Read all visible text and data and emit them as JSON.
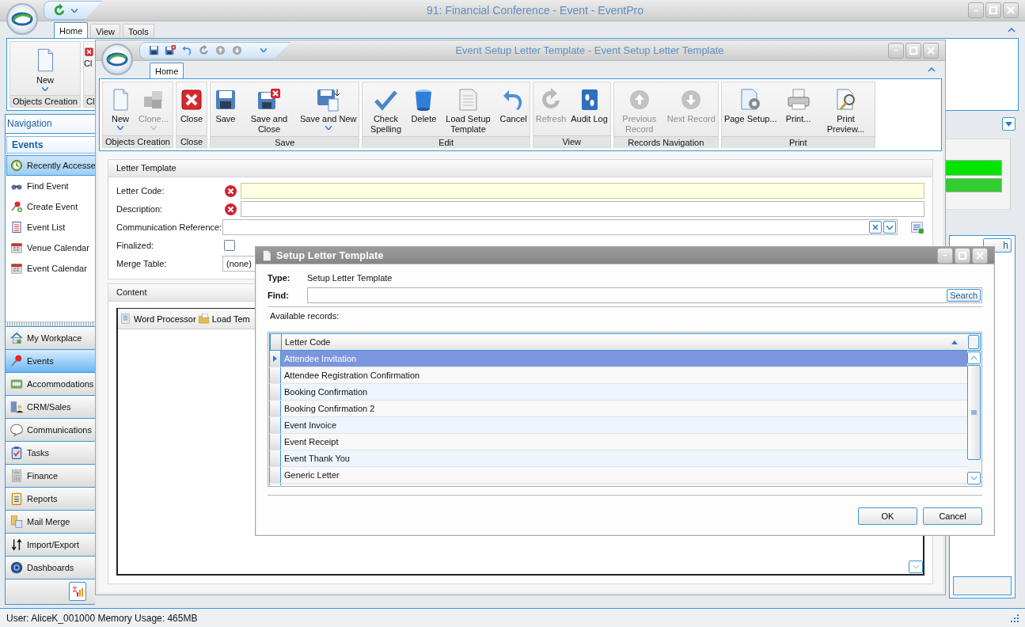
{
  "main_window": {
    "title": "91: Financial Conference - Event - EventPro",
    "tabs": [
      {
        "label": "Home",
        "selected": true
      },
      {
        "label": "View",
        "selected": false
      },
      {
        "label": "Tools",
        "selected": false
      }
    ],
    "ribbon_groups": [
      {
        "label": "Objects Creation",
        "buttons": [
          {
            "label": "New",
            "dropdown": true
          }
        ]
      },
      {
        "label": "Cl",
        "buttons": [
          {
            "label": "Cl",
            "dropdown": false
          }
        ]
      }
    ],
    "navigation": {
      "header": "Navigation",
      "group": "Events",
      "items": [
        {
          "label": "Recently Accesse",
          "selected": true
        },
        {
          "label": "Find Event",
          "selected": false
        },
        {
          "label": "Create Event",
          "selected": false
        },
        {
          "label": "Event List",
          "selected": false
        },
        {
          "label": "Venue Calendar",
          "selected": false
        },
        {
          "label": "Event Calendar",
          "selected": false
        }
      ],
      "modules": [
        {
          "label": "My Workplace",
          "selected": false
        },
        {
          "label": "Events",
          "selected": true
        },
        {
          "label": "Accommodations",
          "selected": false
        },
        {
          "label": "CRM/Sales",
          "selected": false
        },
        {
          "label": "Communications",
          "selected": false
        },
        {
          "label": "Tasks",
          "selected": false
        },
        {
          "label": "Finance",
          "selected": false
        },
        {
          "label": "Reports",
          "selected": false
        },
        {
          "label": "Mail Merge",
          "selected": false
        },
        {
          "label": "Import/Export",
          "selected": false
        },
        {
          "label": "Dashboards",
          "selected": false
        }
      ]
    },
    "workspace": {
      "button_label": "h"
    },
    "status_bar": "User: AliceK_001000  Memory Usage: 465MB"
  },
  "letter_window": {
    "title": "Event Setup Letter Template - Event Setup Letter Template",
    "tabs": [
      {
        "label": "Home",
        "selected": true
      }
    ],
    "ribbon_groups": [
      {
        "label": "Objects Creation",
        "buttons": [
          {
            "label": "New",
            "dropdown": true,
            "disabled": false
          },
          {
            "label": "Clone...",
            "dropdown": true,
            "disabled": true
          }
        ]
      },
      {
        "label": "Close",
        "buttons": [
          {
            "label": "Close",
            "dropdown": false,
            "disabled": false
          }
        ]
      },
      {
        "label": "Save",
        "buttons": [
          {
            "label": "Save",
            "dropdown": false,
            "disabled": false
          },
          {
            "label": "Save and Close",
            "dropdown": false,
            "disabled": false
          },
          {
            "label": "Save and New",
            "dropdown": true,
            "disabled": false
          }
        ]
      },
      {
        "label": "Edit",
        "buttons": [
          {
            "label": "Check Spelling",
            "dropdown": false,
            "disabled": false
          },
          {
            "label": "Delete",
            "dropdown": false,
            "disabled": false
          },
          {
            "label": "Load Setup Template",
            "dropdown": false,
            "disabled": false
          },
          {
            "label": "Cancel",
            "dropdown": false,
            "disabled": false
          }
        ]
      },
      {
        "label": "View",
        "buttons": [
          {
            "label": "Refresh",
            "dropdown": false,
            "disabled": true
          },
          {
            "label": "Audit Log",
            "dropdown": false,
            "disabled": false
          }
        ]
      },
      {
        "label": "Records Navigation",
        "buttons": [
          {
            "label": "Previous Record",
            "dropdown": false,
            "disabled": true
          },
          {
            "label": "Next Record",
            "dropdown": false,
            "disabled": true
          }
        ]
      },
      {
        "label": "Print",
        "buttons": [
          {
            "label": "Page Setup...",
            "dropdown": false,
            "disabled": false
          },
          {
            "label": "Print...",
            "dropdown": false,
            "disabled": false
          },
          {
            "label": "Print Preview...",
            "dropdown": false,
            "disabled": false
          }
        ]
      }
    ],
    "form": {
      "title": "Letter Template",
      "fields": [
        {
          "kind": "text",
          "label": "Letter Code:",
          "required": true,
          "focused": true
        },
        {
          "kind": "text",
          "label": "Description:",
          "required": true,
          "focused": false
        },
        {
          "kind": "lookup",
          "label": "Communication Reference:",
          "required": false,
          "focused": false
        },
        {
          "kind": "checkbox",
          "label": "Finalized:",
          "checked": false
        },
        {
          "kind": "select",
          "label": "Merge Table:",
          "value": "(none)"
        }
      ]
    },
    "content": {
      "title": "Content",
      "tools": [
        "Word Processor",
        "Load Tem"
      ]
    }
  },
  "dialog": {
    "title": "Setup Letter Template",
    "type_label": "Type:",
    "type_value": "Setup Letter Template",
    "find_label": "Find:",
    "search_button": "Search",
    "records_label": "Available records:",
    "column": "Letter Code",
    "rows": [
      {
        "label": "Attendee Invitation",
        "selected": true
      },
      {
        "label": "Attendee Registration Confirmation",
        "selected": false
      },
      {
        "label": "Booking Confirmation",
        "selected": false
      },
      {
        "label": "Booking Confirmation 2",
        "selected": false
      },
      {
        "label": "Event Invoice",
        "selected": false
      },
      {
        "label": "Event Receipt",
        "selected": false
      },
      {
        "label": "Event Thank You",
        "selected": false
      },
      {
        "label": "Generic Letter",
        "selected": false
      }
    ],
    "buttons": [
      "OK",
      "Cancel"
    ]
  }
}
